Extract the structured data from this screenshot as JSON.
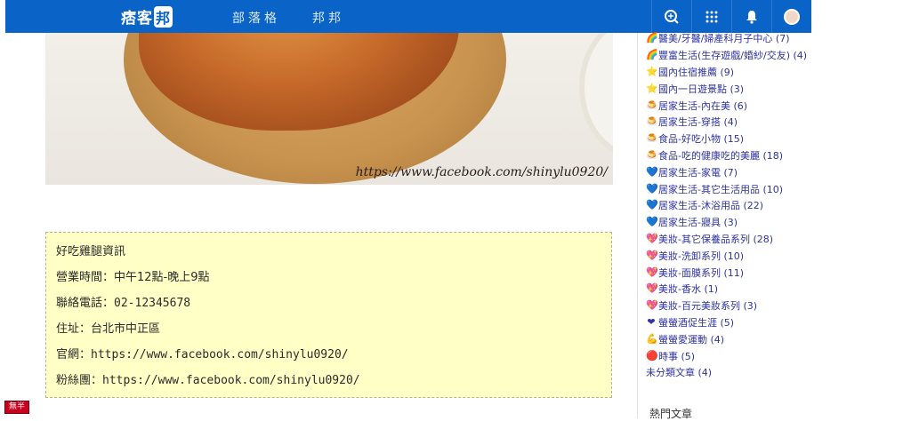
{
  "topbar": {
    "brand": "痞客",
    "brand_box": "邦",
    "links": [
      "部落格",
      "邦邦"
    ]
  },
  "photo": {
    "watermark": "https://www.facebook.com/shinylu0920/"
  },
  "info": {
    "lines": [
      {
        "label": "好吃雞腿資訊",
        "value": ""
      },
      {
        "label": "營業時間：",
        "value": "中午12點-晚上9點"
      },
      {
        "label": "聯絡電話：",
        "value": "02-12345678"
      },
      {
        "label": "住址：",
        "value": "台北市中正區"
      },
      {
        "label": "官網：",
        "value": "https://www.facebook.com/shinylu0920/"
      },
      {
        "label": "粉絲團：",
        "value": "https://www.facebook.com/shinylu0920/"
      }
    ]
  },
  "sidebar": {
    "categories": [
      {
        "icon": "rainbow-icon",
        "glyph": "🌈",
        "label": "醫美/牙醫/婦產科月子中心 (7)"
      },
      {
        "icon": "rainbow-icon",
        "glyph": "🌈",
        "label": "豐富生活(生存遊戲/婚紗/交友) (4)"
      },
      {
        "icon": "star-icon",
        "glyph": "⭐",
        "label": "國內住宿推薦 (9)"
      },
      {
        "icon": "star-icon",
        "glyph": "⭐",
        "label": "國內一日遊景點 (3)"
      },
      {
        "icon": "pudding-icon",
        "glyph": "🍮",
        "label": "居家生活-內在美 (6)"
      },
      {
        "icon": "pudding-icon",
        "glyph": "🍮",
        "label": "居家生活-穿搭 (4)"
      },
      {
        "icon": "pudding-icon",
        "glyph": "🍮",
        "label": "食品-好吃小物 (15)"
      },
      {
        "icon": "pudding-icon",
        "glyph": "🍮",
        "label": "食品-吃的健康吃的美麗 (18)"
      },
      {
        "icon": "blue-heart-icon",
        "glyph": "💙",
        "label": "居家生活-家電 (7)"
      },
      {
        "icon": "blue-heart-icon",
        "glyph": "💙",
        "label": "居家生活-其它生活用品 (10)"
      },
      {
        "icon": "blue-heart-icon",
        "glyph": "💙",
        "label": "居家生活-沐浴用品 (22)"
      },
      {
        "icon": "blue-heart-icon",
        "glyph": "💙",
        "label": "居家生活-寢具 (3)"
      },
      {
        "icon": "sparkle-heart-icon",
        "glyph": "💖",
        "label": "美妝-其它保養品系列 (28)"
      },
      {
        "icon": "sparkle-heart-icon",
        "glyph": "💖",
        "label": "美妝-洗卸系列 (10)"
      },
      {
        "icon": "sparkle-heart-icon",
        "glyph": "💖",
        "label": "美妝-面膜系列 (11)"
      },
      {
        "icon": "sparkle-heart-icon",
        "glyph": "💖",
        "label": "美妝-香水 (1)"
      },
      {
        "icon": "sparkle-heart-icon",
        "glyph": "💖",
        "label": "美妝-百元美妝系列 (3)"
      },
      {
        "icon": "heart-icon",
        "glyph": "❤",
        "label": "螢螢酒促生涯 (5)"
      },
      {
        "icon": "muscle-icon",
        "glyph": "💪",
        "label": "螢螢愛運動 (4)"
      },
      {
        "icon": "red-circle-icon",
        "glyph": "🔴",
        "label": "時事 (5)"
      },
      {
        "icon": "",
        "glyph": "",
        "label": "未分類文章 (4)"
      }
    ],
    "hot_title": "熱門文章"
  },
  "badge": "無半"
}
